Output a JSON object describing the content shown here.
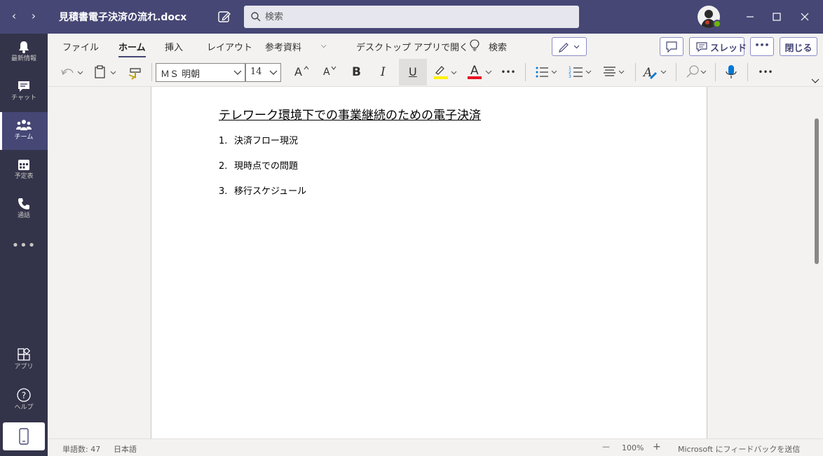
{
  "titlebar": {
    "back_label": "‹",
    "forward_label": "›",
    "doc_title": "見積書電子決済の流れ.docx",
    "search_placeholder": "検索"
  },
  "rail": {
    "items": [
      {
        "label": "最新情報",
        "icon": "bell-icon"
      },
      {
        "label": "チャット",
        "icon": "chat-icon"
      },
      {
        "label": "チーム",
        "icon": "teams-icon"
      },
      {
        "label": "予定表",
        "icon": "calendar-icon"
      },
      {
        "label": "通話",
        "icon": "phone-icon"
      }
    ],
    "more_label": "•••",
    "apps_label": "アプリ",
    "help_label": "ヘルプ"
  },
  "ribbon": {
    "tabs": [
      "ファイル",
      "ホーム",
      "挿入",
      "レイアウト",
      "参考資料",
      "デスクトップ アプリで開く",
      "検索"
    ],
    "active_tab": "ホーム",
    "thread_label": "スレッド",
    "more_label": "•••",
    "close_label": "閉じる"
  },
  "toolbar": {
    "font_name": "ＭＳ 明朝",
    "font_size": "14",
    "bold": "B",
    "italic": "I",
    "underline": "U",
    "grow_font": "A",
    "shrink_font": "A",
    "font_color": "A",
    "more": "•••",
    "more2": "•••",
    "highlight_color": "#fff100",
    "font_color_value": "#e81123"
  },
  "document": {
    "heading": "テレワーク環境下での事業継続のための電子決済",
    "items": [
      {
        "num": "1.",
        "text": "決済フロー現況"
      },
      {
        "num": "2.",
        "text": "現時点での問題"
      },
      {
        "num": "3.",
        "text": "移行スケジュール"
      }
    ]
  },
  "status": {
    "word_count": "単語数: 47",
    "language": "日本語",
    "zoom_out": "—",
    "zoom": "100%",
    "zoom_in": "+",
    "feedback": "Microsoft にフィードバックを送信"
  },
  "colors": {
    "titlebar": "#464775",
    "rail": "#33344a",
    "accent": "#464775"
  }
}
